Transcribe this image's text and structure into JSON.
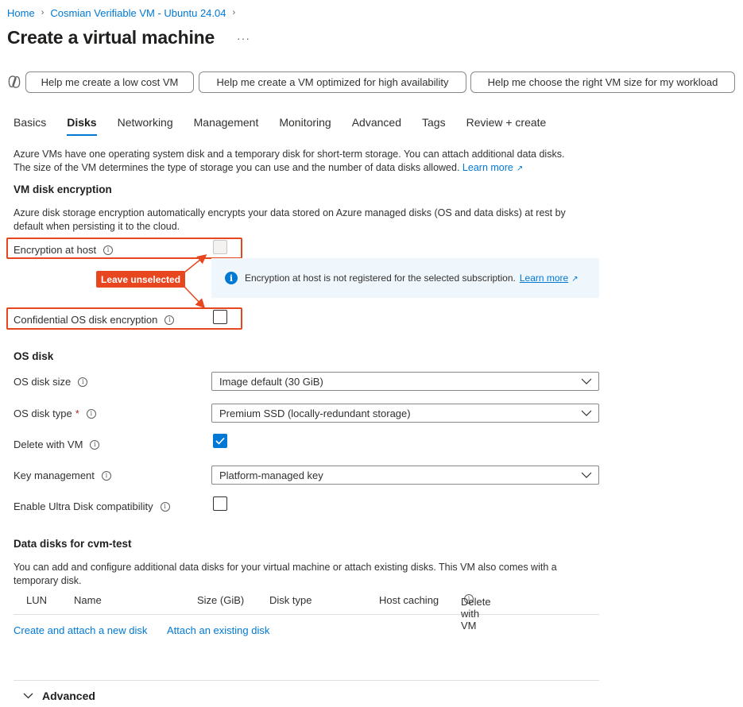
{
  "breadcrumb": {
    "home": "Home",
    "current": "Cosmian Verifiable VM - Ubuntu 24.04"
  },
  "page": {
    "title": "Create a virtual machine",
    "more": "···"
  },
  "copilot": {
    "prompts": [
      "Help me create a low cost VM",
      "Help me create a VM optimized for high availability",
      "Help me choose the right VM size for my workload"
    ]
  },
  "tabs": [
    "Basics",
    "Disks",
    "Networking",
    "Management",
    "Monitoring",
    "Advanced",
    "Tags",
    "Review + create"
  ],
  "active_tab": "Disks",
  "intro": {
    "line1": "Azure VMs have one operating system disk and a temporary disk for short-term storage. You can attach additional data disks.",
    "line2": "The size of the VM determines the type of storage you can use and the number of data disks allowed.",
    "learn_more": "Learn more"
  },
  "encryption": {
    "heading": "VM disk encryption",
    "desc1": "Azure disk storage encryption automatically encrypts your data stored on Azure managed disks (OS and data disks) at rest by",
    "desc2": "default when persisting it to the cloud.",
    "host_label": "Encryption at host",
    "host_checked": false,
    "info_text": "Encryption at host is not registered for the selected subscription.",
    "info_link": "Learn more",
    "confidential_label": "Confidential OS disk encryption",
    "confidential_checked": false,
    "callout": "Leave unselected"
  },
  "os_disk": {
    "heading": "OS disk",
    "size_label": "OS disk size",
    "size_value": "Image default (30 GiB)",
    "type_label": "OS disk type",
    "type_required": "*",
    "type_value": "Premium SSD (locally-redundant storage)",
    "delete_label": "Delete with VM",
    "delete_checked": true,
    "key_label": "Key management",
    "key_value": "Platform-managed key",
    "ultra_label": "Enable Ultra Disk compatibility",
    "ultra_checked": false
  },
  "data_disks": {
    "heading": "Data disks for cvm-test",
    "desc1": "You can add and configure additional data disks for your virtual machine or attach existing disks. This VM also comes with a",
    "desc2": "temporary disk.",
    "columns": [
      "LUN",
      "Name",
      "Size (GiB)",
      "Disk type",
      "Host caching",
      "Delete with VM"
    ],
    "create_link": "Create and attach a new disk",
    "attach_link": "Attach an existing disk"
  },
  "advanced": {
    "label": "Advanced"
  },
  "colors": {
    "accent": "#0078d4",
    "annotation": "#e8461e",
    "info_bg": "#eff6fc"
  },
  "icons": {
    "copilot": "copilot-icon",
    "info": "info-icon",
    "chevron": "chevron-down-icon",
    "external": "external-link-icon",
    "check": "checkmark-icon"
  }
}
